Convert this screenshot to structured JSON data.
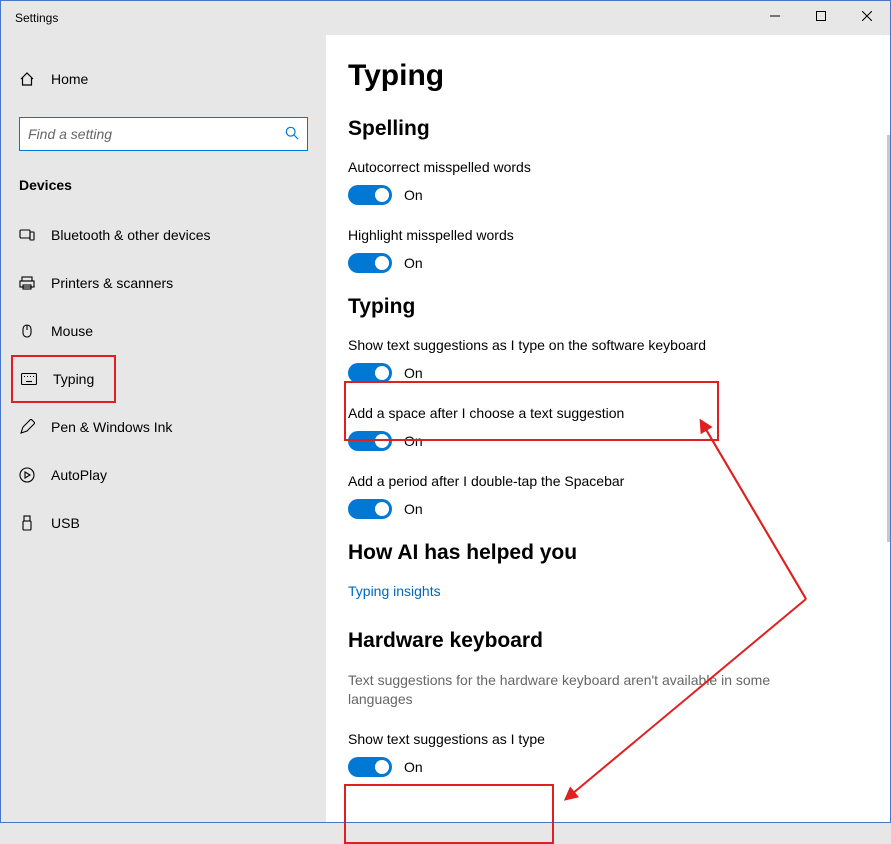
{
  "window": {
    "title": "Settings"
  },
  "sidebar": {
    "home": "Home",
    "search_placeholder": "Find a setting",
    "section": "Devices",
    "items": [
      {
        "label": "Bluetooth & other devices"
      },
      {
        "label": "Printers & scanners"
      },
      {
        "label": "Mouse"
      },
      {
        "label": "Typing"
      },
      {
        "label": "Pen & Windows Ink"
      },
      {
        "label": "AutoPlay"
      },
      {
        "label": "USB"
      }
    ]
  },
  "page": {
    "title": "Typing",
    "spelling": {
      "heading": "Spelling",
      "autocorrect": {
        "label": "Autocorrect misspelled words",
        "state": "On"
      },
      "highlight": {
        "label": "Highlight misspelled words",
        "state": "On"
      }
    },
    "typing": {
      "heading": "Typing",
      "suggestions": {
        "label": "Show text suggestions as I type on the software keyboard",
        "state": "On"
      },
      "space": {
        "label": "Add a space after I choose a text suggestion",
        "state": "On"
      },
      "period": {
        "label": "Add a period after I double-tap the Spacebar",
        "state": "On"
      }
    },
    "ai": {
      "heading": "How AI has helped you",
      "link": "Typing insights"
    },
    "hardware": {
      "heading": "Hardware keyboard",
      "desc": "Text suggestions for the hardware keyboard aren't available in some languages",
      "suggestions": {
        "label": "Show text suggestions as I type",
        "state": "On"
      }
    }
  }
}
